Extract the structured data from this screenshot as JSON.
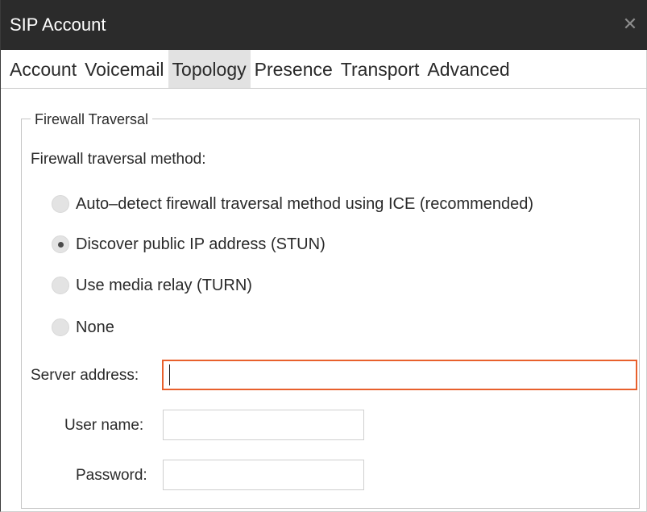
{
  "window": {
    "title": "SIP Account",
    "close_glyph": "✕"
  },
  "tabs": [
    {
      "label": "Account",
      "active": false
    },
    {
      "label": "Voicemail",
      "active": false
    },
    {
      "label": "Topology",
      "active": true
    },
    {
      "label": "Presence",
      "active": false
    },
    {
      "label": "Transport",
      "active": false
    },
    {
      "label": "Advanced",
      "active": false
    }
  ],
  "firewall": {
    "group_label": "Firewall Traversal",
    "method_label": "Firewall traversal method:",
    "options": [
      {
        "label": "Auto–detect firewall traversal method using ICE (recommended)",
        "checked": false
      },
      {
        "label": "Discover public IP address (STUN)",
        "checked": true
      },
      {
        "label": "Use media relay (TURN)",
        "checked": false
      },
      {
        "label": "None",
        "checked": false
      }
    ],
    "server_address": {
      "label": "Server address:",
      "value": ""
    },
    "user_name": {
      "label": "User name:",
      "value": ""
    },
    "password": {
      "label": "Password:",
      "value": ""
    }
  },
  "colors": {
    "titlebar": "#2b2b2b",
    "active_tab": "#e2e2e2",
    "focus_border": "#e8602c"
  }
}
